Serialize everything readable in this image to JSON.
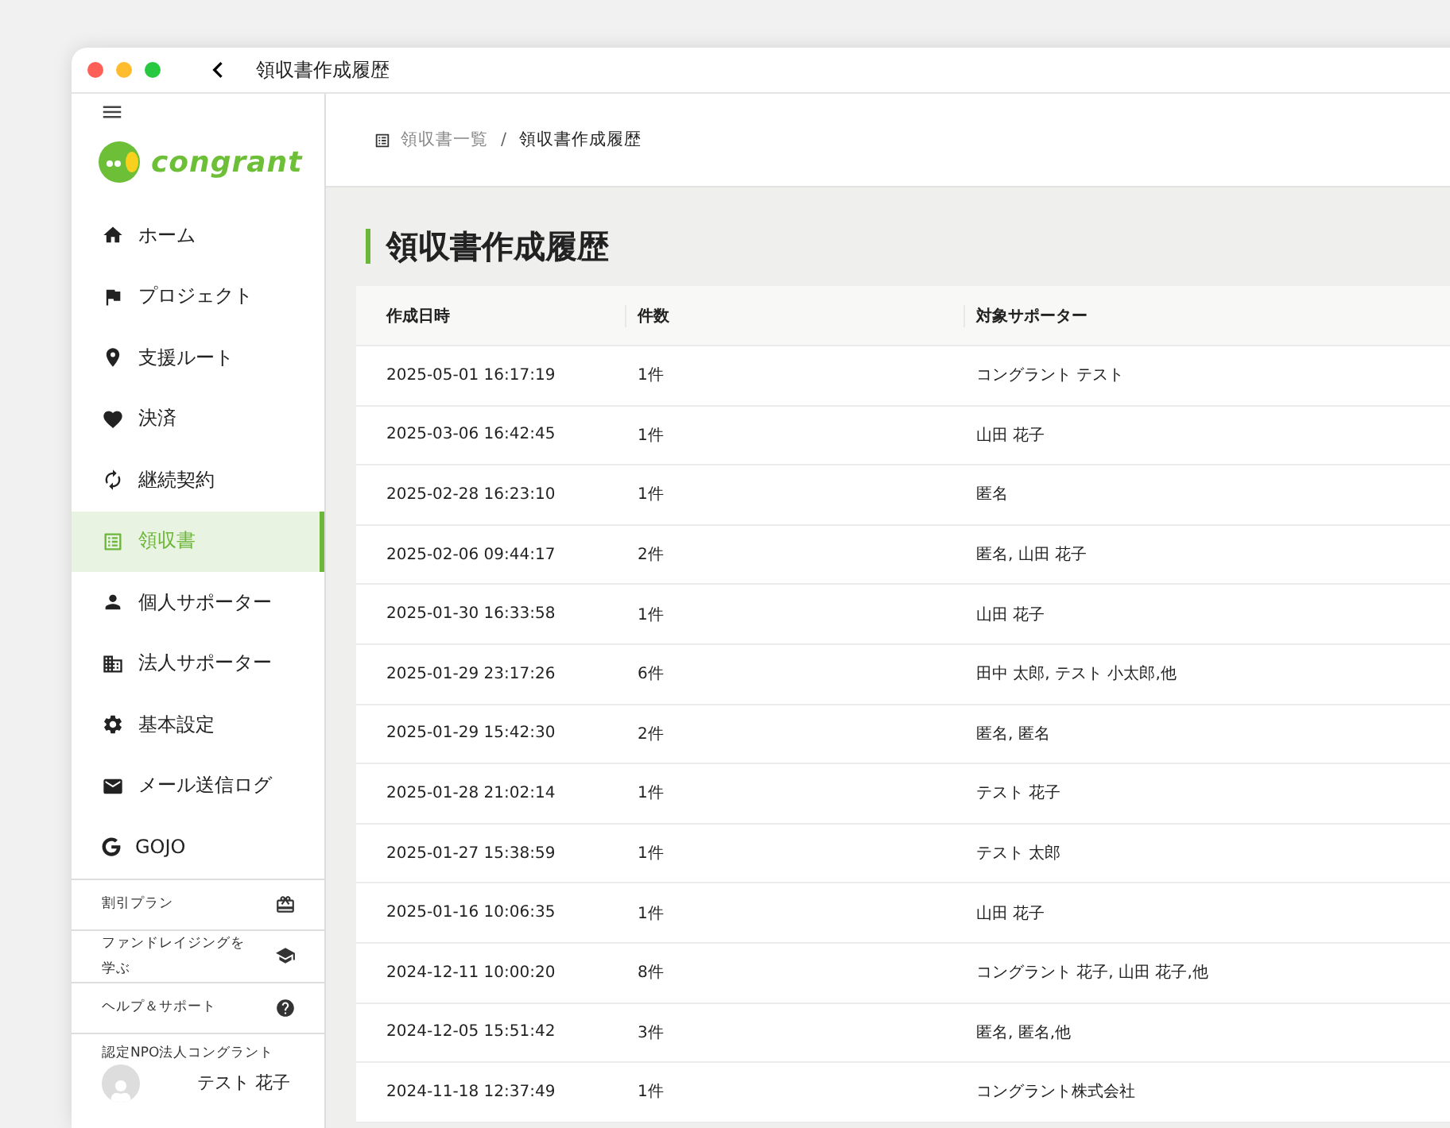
{
  "window": {
    "title": "領収書作成履歴"
  },
  "sidebar": {
    "logo_text": "congrant",
    "items": [
      {
        "label": "ホーム",
        "selected": false
      },
      {
        "label": "プロジェクト",
        "selected": false
      },
      {
        "label": "支援ルート",
        "selected": false
      },
      {
        "label": "決済",
        "selected": false
      },
      {
        "label": "継続契約",
        "selected": false
      },
      {
        "label": "領収書",
        "selected": true
      },
      {
        "label": "個人サポーター",
        "selected": false
      },
      {
        "label": "法人サポーター",
        "selected": false
      },
      {
        "label": "基本設定",
        "selected": false
      },
      {
        "label": "メール送信ログ",
        "selected": false
      },
      {
        "label": "GOJO",
        "selected": false
      }
    ],
    "links": [
      {
        "label": "割引プラン"
      },
      {
        "label": "ファンドレイジングを学ぶ"
      },
      {
        "label": "ヘルプ＆サポート"
      }
    ],
    "account": {
      "organization": "認定NPO法人コングラント",
      "user": "テスト 花子"
    }
  },
  "breadcrumb": [
    {
      "label": "領収書一覧"
    },
    {
      "label": "領収書作成履歴"
    }
  ],
  "breadcrumb_separator": "/",
  "page_title": "領収書作成履歴",
  "table": {
    "columns": [
      "作成日時",
      "件数",
      "対象サポーター"
    ],
    "rows": [
      [
        "2025-05-01 16:17:19",
        "1件",
        "コングラント テスト"
      ],
      [
        "2025-03-06 16:42:45",
        "1件",
        "山田 花子"
      ],
      [
        "2025-02-28 16:23:10",
        "1件",
        "匿名"
      ],
      [
        "2025-02-06 09:44:17",
        "2件",
        "匿名, 山田 花子"
      ],
      [
        "2025-01-30 16:33:58",
        "1件",
        "山田 花子"
      ],
      [
        "2025-01-29 23:17:26",
        "6件",
        "田中 太郎, テスト 小太郎,他"
      ],
      [
        "2025-01-29 15:42:30",
        "2件",
        "匿名, 匿名"
      ],
      [
        "2025-01-28 21:02:14",
        "1件",
        "テスト 花子"
      ],
      [
        "2025-01-27 15:38:59",
        "1件",
        "テスト 太郎"
      ],
      [
        "2025-01-16 10:06:35",
        "1件",
        "山田 花子"
      ],
      [
        "2024-12-11 10:00:20",
        "8件",
        "コングラント 花子, 山田 花子,他"
      ],
      [
        "2024-12-05 15:51:42",
        "3件",
        "匿名, 匿名,他"
      ],
      [
        "2024-11-18 12:37:49",
        "1件",
        "コングラント株式会社"
      ]
    ]
  }
}
